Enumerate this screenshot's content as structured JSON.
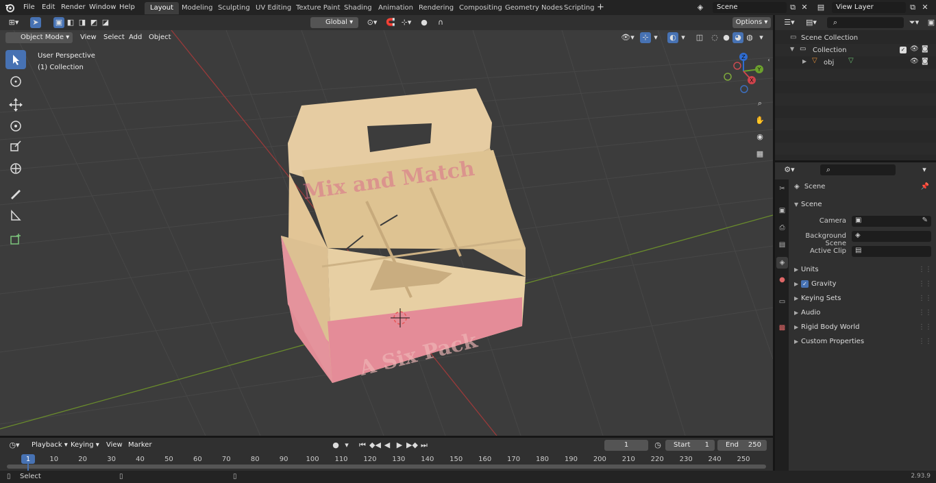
{
  "menubar": {
    "items": [
      "File",
      "Edit",
      "Render",
      "Window",
      "Help"
    ],
    "workspaces": [
      "Layout",
      "Modeling",
      "Sculpting",
      "UV Editing",
      "Texture Paint",
      "Shading",
      "Animation",
      "Rendering",
      "Compositing",
      "Geometry Nodes",
      "Scripting"
    ],
    "active_workspace": "Layout",
    "add_tab": "+",
    "scene": "Scene",
    "view_layer": "View Layer"
  },
  "viewport": {
    "transform_orientation": "Global",
    "options_label": "Options",
    "mode": "Object Mode",
    "menus": [
      "View",
      "Select",
      "Add",
      "Object"
    ],
    "overlay_line1": "User Perspective",
    "overlay_line2": "(1) Collection",
    "gizmo_axes": {
      "x": "X",
      "y": "Y",
      "z": "Z"
    },
    "carton_top_text": "Mix and Match",
    "carton_bottom_text": "A Six Pack",
    "colors": {
      "background": "#3c3c3c",
      "grid": "#454545",
      "x_axis": "#9b3a3a",
      "y_axis": "#6a8c2c",
      "carton": "#e3c79a",
      "carton_pink": "#e18b95",
      "accent": "#4772b3"
    }
  },
  "outliner": {
    "root": "Scene Collection",
    "collection": "Collection",
    "object": "obj"
  },
  "properties": {
    "context": "Scene",
    "panel_title": "Scene",
    "fields": [
      {
        "label": "Camera"
      },
      {
        "label": "Background Scene"
      },
      {
        "label": "Active Clip"
      }
    ],
    "panels": [
      "Units",
      "Gravity",
      "Keying Sets",
      "Audio",
      "Rigid Body World",
      "Custom Properties"
    ],
    "gravity_checked": true
  },
  "timeline": {
    "menus": [
      "Playback",
      "Keying",
      "View",
      "Marker"
    ],
    "current_frame": "1",
    "start_label": "Start",
    "start": "1",
    "end_label": "End",
    "end": "250",
    "ticks": [
      "1",
      "10",
      "20",
      "30",
      "40",
      "50",
      "60",
      "70",
      "80",
      "90",
      "100",
      "110",
      "120",
      "130",
      "140",
      "150",
      "160",
      "170",
      "180",
      "190",
      "200",
      "210",
      "220",
      "230",
      "240",
      "250"
    ]
  },
  "statusbar": {
    "left": "Select",
    "version": "2.93.9"
  }
}
